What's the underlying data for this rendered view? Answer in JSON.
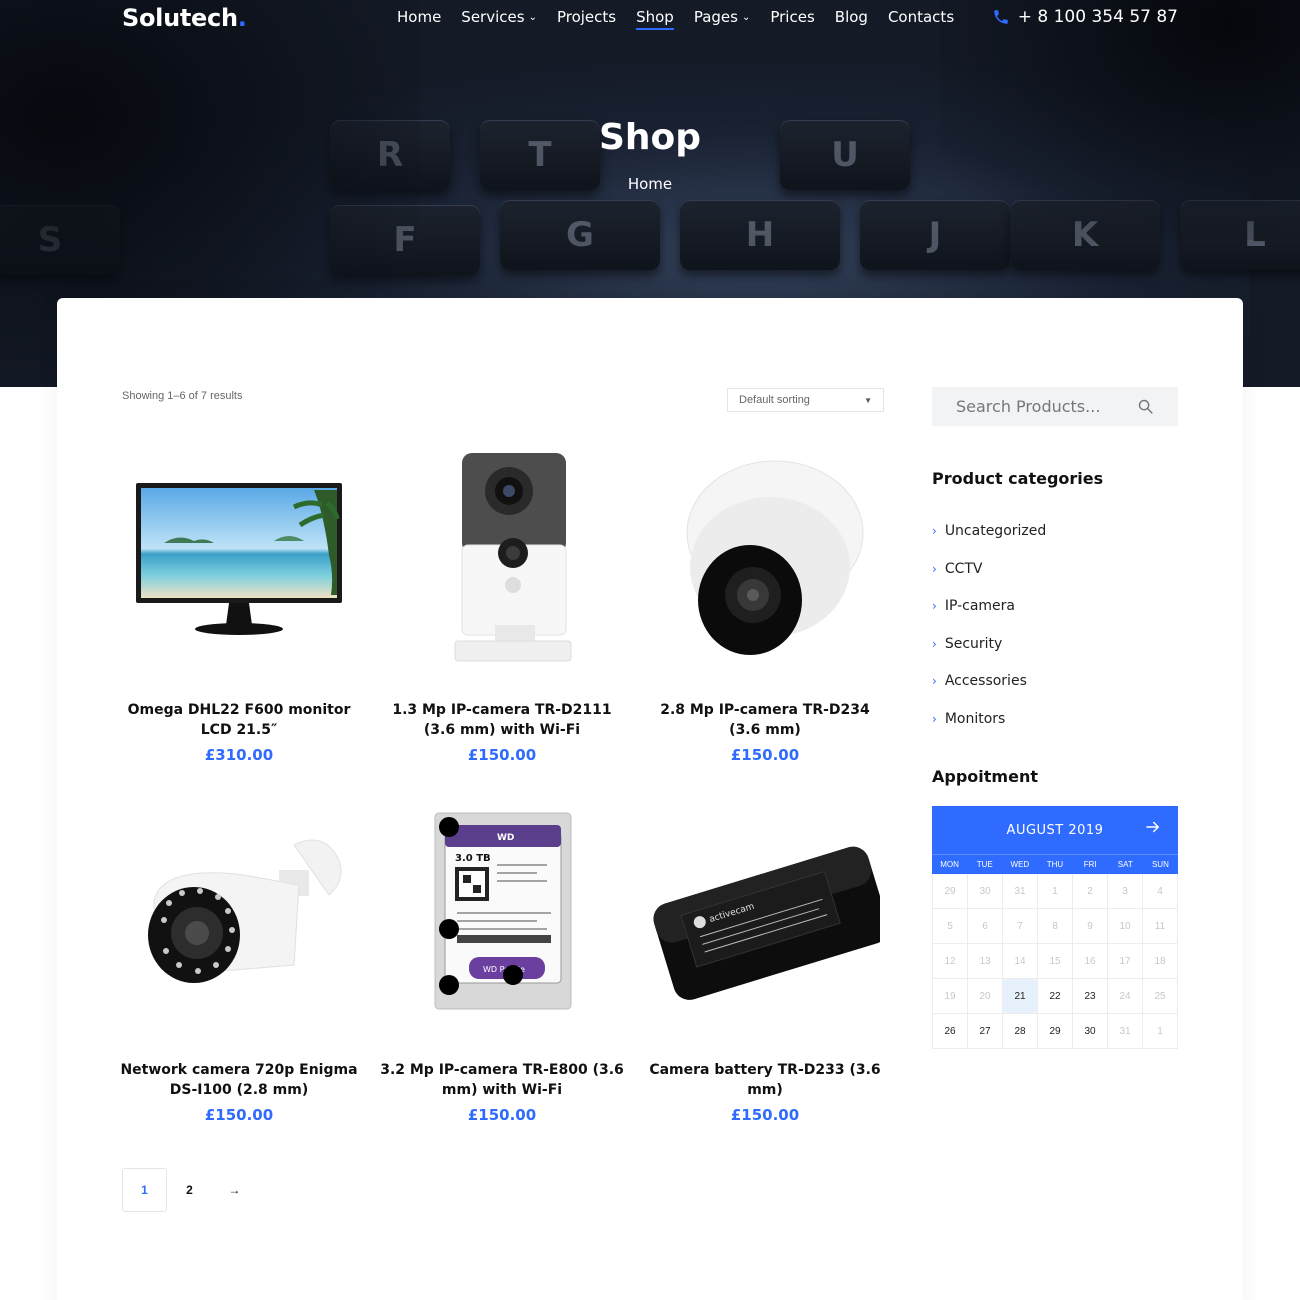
{
  "header": {
    "logo": "Solutech",
    "logo_dot": ".",
    "nav": [
      {
        "label": "Home",
        "dropdown": false,
        "active": false
      },
      {
        "label": "Services",
        "dropdown": true,
        "active": false
      },
      {
        "label": "Projects",
        "dropdown": false,
        "active": false
      },
      {
        "label": "Shop",
        "dropdown": false,
        "active": true
      },
      {
        "label": "Pages",
        "dropdown": true,
        "active": false
      },
      {
        "label": "Prices",
        "dropdown": false,
        "active": false
      },
      {
        "label": "Blog",
        "dropdown": false,
        "active": false
      },
      {
        "label": "Contacts",
        "dropdown": false,
        "active": false
      }
    ],
    "phone": "+ 8 100 354 57 87",
    "phone_icon": "phone-icon"
  },
  "hero": {
    "title": "Shop",
    "breadcrumb": "Home",
    "keys": [
      "R",
      "T",
      "U",
      "S",
      "F",
      "G",
      "H",
      "J",
      "K",
      "L"
    ]
  },
  "shop": {
    "result_count": "Showing 1–6 of 7 results",
    "sorting": "Default sorting",
    "products": [
      {
        "name": "Omega DHL22 F600 monitor LCD 21.5″",
        "price": "£310.00",
        "image": "monitor"
      },
      {
        "name": "1.3 Mp IP-camera TR-D2111 (3.6 mm) with Wi-Fi",
        "price": "£150.00",
        "image": "cube-camera"
      },
      {
        "name": "2.8 Mp IP-camera TR-D234 (3.6 mm)",
        "price": "£150.00",
        "image": "dome-camera"
      },
      {
        "name": "Network camera 720p Enigma DS-I100 (2.8 mm)",
        "price": "£150.00",
        "image": "bullet-camera"
      },
      {
        "name": "3.2 Mp IP-camera TR-E800 (3.6 mm) with Wi-Fi",
        "price": "£150.00",
        "image": "hard-drive"
      },
      {
        "name": "Camera battery TR-D233 (3.6 mm)",
        "price": "£150.00",
        "image": "power-adapter"
      }
    ],
    "hdd_label": {
      "brand": "WD",
      "capacity": "3.0 TB",
      "model": "WD Purple"
    },
    "adapter_label": "activecam",
    "pagination": [
      "1",
      "2",
      "→"
    ],
    "current_page": "1"
  },
  "sidebar": {
    "search_placeholder": "Search Products...",
    "categories_title": "Product categories",
    "categories": [
      "Uncategorized",
      "CCTV",
      "IP-camera",
      "Security",
      "Accessories",
      "Monitors"
    ],
    "calendar_title": "Appoitment",
    "calendar": {
      "month": "AUGUST 2019",
      "days_of_week": [
        "MON",
        "TUE",
        "WED",
        "THU",
        "FRI",
        "SAT",
        "SUN"
      ],
      "cells": [
        {
          "d": "29",
          "muted": true
        },
        {
          "d": "30",
          "muted": true
        },
        {
          "d": "31",
          "muted": true
        },
        {
          "d": "1",
          "muted": true
        },
        {
          "d": "2",
          "muted": true
        },
        {
          "d": "3",
          "muted": true
        },
        {
          "d": "4",
          "muted": true
        },
        {
          "d": "5",
          "muted": true
        },
        {
          "d": "6",
          "muted": true
        },
        {
          "d": "7",
          "muted": true
        },
        {
          "d": "8",
          "muted": true
        },
        {
          "d": "9",
          "muted": true
        },
        {
          "d": "10",
          "muted": true
        },
        {
          "d": "11",
          "muted": true
        },
        {
          "d": "12",
          "muted": true
        },
        {
          "d": "13",
          "muted": true
        },
        {
          "d": "14",
          "muted": true
        },
        {
          "d": "15",
          "muted": true
        },
        {
          "d": "16",
          "muted": true
        },
        {
          "d": "17",
          "muted": true
        },
        {
          "d": "18",
          "muted": true
        },
        {
          "d": "19",
          "muted": true
        },
        {
          "d": "20",
          "muted": true
        },
        {
          "d": "21",
          "muted": false,
          "today": true
        },
        {
          "d": "22",
          "muted": false
        },
        {
          "d": "23",
          "muted": false
        },
        {
          "d": "24",
          "muted": true
        },
        {
          "d": "25",
          "muted": true
        },
        {
          "d": "26",
          "muted": false
        },
        {
          "d": "27",
          "muted": false
        },
        {
          "d": "28",
          "muted": false
        },
        {
          "d": "29",
          "muted": false
        },
        {
          "d": "30",
          "muted": false
        },
        {
          "d": "31",
          "muted": true
        },
        {
          "d": "1",
          "muted": true
        }
      ]
    }
  },
  "colors": {
    "accent": "#2f6bff",
    "today": "#e7f1fb"
  }
}
